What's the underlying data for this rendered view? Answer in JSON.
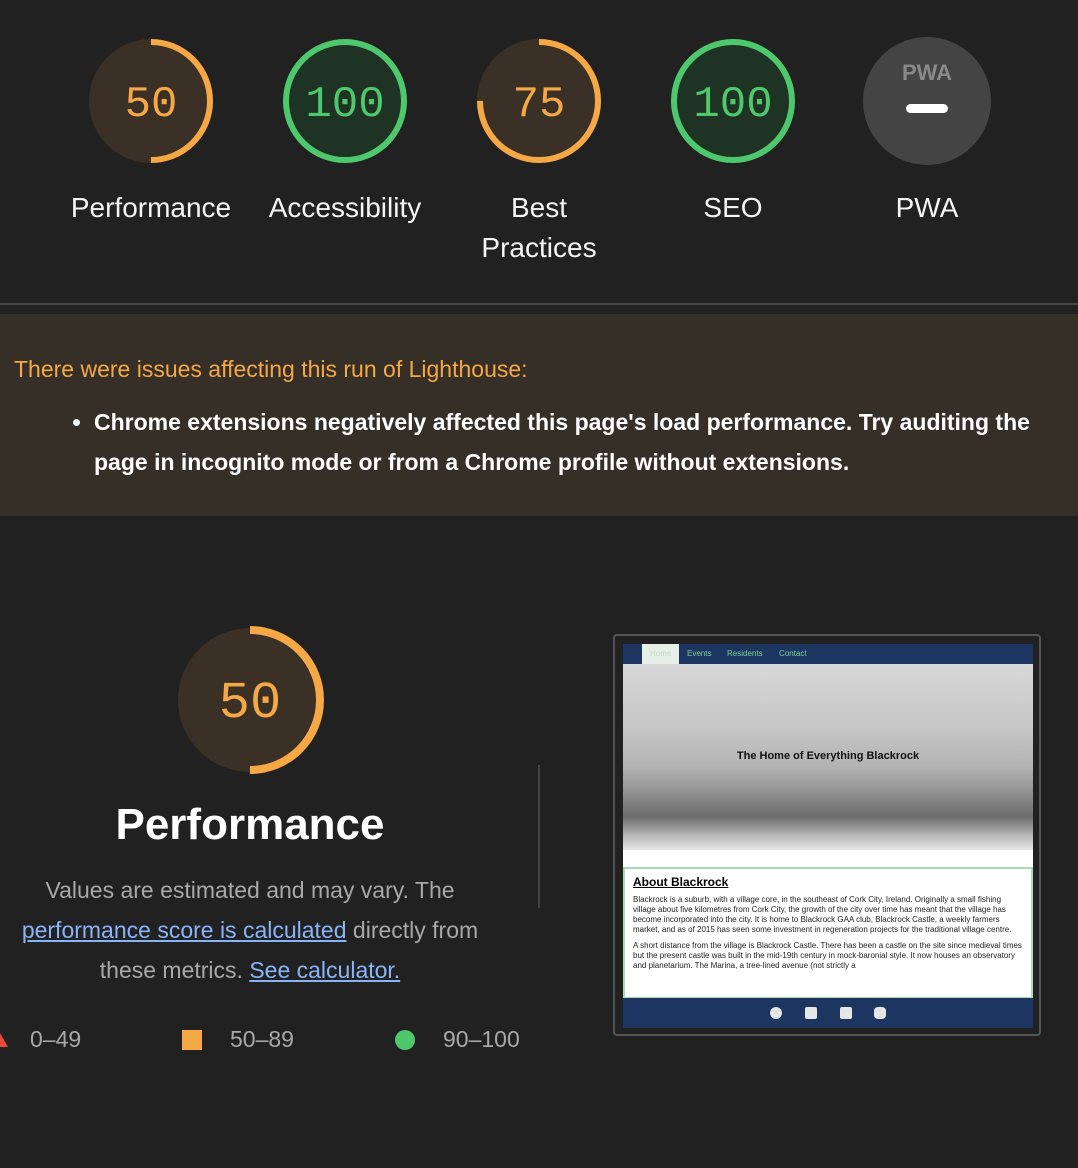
{
  "categories": [
    {
      "score": "50",
      "fraction": 0.5,
      "label": "Performance",
      "status": "average"
    },
    {
      "score": "100",
      "fraction": 1.0,
      "label": "Accessibility",
      "status": "pass"
    },
    {
      "score": "75",
      "fraction": 0.75,
      "label": "Best Practices",
      "status": "average"
    },
    {
      "score": "100",
      "fraction": 1.0,
      "label": "SEO",
      "status": "pass"
    },
    {
      "score": "",
      "fraction": null,
      "label": "PWA",
      "status": "na",
      "badge": "PWA"
    }
  ],
  "colors": {
    "average": "#f5a845",
    "average_bg": "#3b3026",
    "pass": "#4ec86d",
    "pass_bg": "#1f3324",
    "fail": "#e64a3b",
    "na_bg": "#444444"
  },
  "warning": {
    "title": "There were issues affecting this run of Lighthouse:",
    "items": [
      "Chrome extensions negatively affected this page's load performance. Try auditing the page in incognito mode or from a Chrome profile without extensions."
    ]
  },
  "performance": {
    "score": "50",
    "fraction": 0.5,
    "title": "Performance",
    "desc_prefix": "Values are estimated and may vary. The ",
    "calc_link": "performance score is calculated",
    "desc_middle": " directly from these metrics.",
    "see_calculator": "See calculator."
  },
  "legend": {
    "fail": "0–49",
    "average": "50–89",
    "pass": "90–100"
  },
  "screenshot": {
    "nav": [
      "Home",
      "Events",
      "Residents",
      "Contact"
    ],
    "hero_title": "The Home of Everything Blackrock",
    "about_heading": "About Blackrock",
    "about_p1": "Blackrock is a suburb, with a village core, in the southeast of Cork City, Ireland. Originally a small fishing village about five kilometres from Cork City, the growth of the city over time has meant that the village has become incorporated into the city. It is home to Blackrock GAA club, Blackrock Castle, a weekly farmers market, and as of 2015 has seen some investment in regeneration projects for the traditional village centre.",
    "about_p2": "A short distance from the village is Blackrock Castle. There has been a castle on the site since medieval times but the present castle was built in the mid-19th century in mock-baronial style. It now houses an observatory and planetarium. The Marina, a tree-lined avenue (not strictly a",
    "footer_icons": [
      "facebook-icon",
      "twitter-icon",
      "youtube-icon",
      "instagram-icon"
    ]
  }
}
